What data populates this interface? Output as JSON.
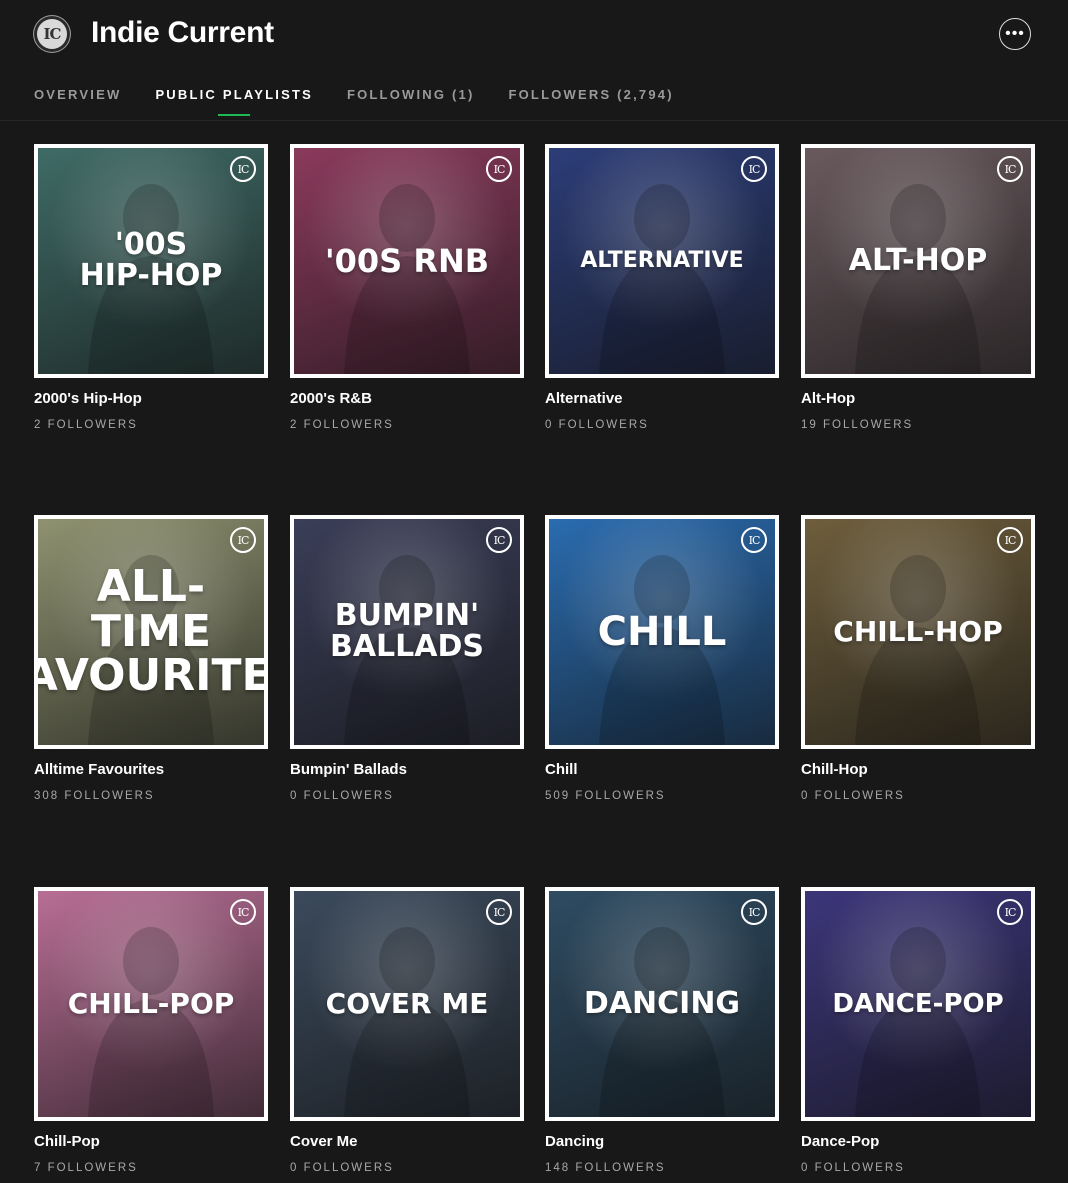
{
  "header": {
    "logo_text": "IC",
    "title": "Indie Current",
    "more_label": "•••"
  },
  "tabs": [
    {
      "label": "OVERVIEW",
      "active": false
    },
    {
      "label": "PUBLIC PLAYLISTS",
      "active": true
    },
    {
      "label": "FOLLOWING (1)",
      "active": false
    },
    {
      "label": "FOLLOWERS (2,794)",
      "active": false
    }
  ],
  "playlists": [
    {
      "name": "2000's Hip-Hop",
      "followers": "2 FOLLOWERS",
      "cover_text": "'00s\nHip-Hop",
      "color": "#3f6b66",
      "text_size": 30
    },
    {
      "name": "2000's R&B",
      "followers": "2 FOLLOWERS",
      "cover_text": "'00s RnB",
      "color": "#8b3a5c",
      "text_size": 32
    },
    {
      "name": "Alternative",
      "followers": "0 FOLLOWERS",
      "cover_text": "Alternative",
      "color": "#2c3d78",
      "text_size": 22
    },
    {
      "name": "Alt-Hop",
      "followers": "19 FOLLOWERS",
      "cover_text": "Alt-Hop",
      "color": "#6a5a5e",
      "text_size": 30
    },
    {
      "name": "Alltime Favourites",
      "followers": "308 FOLLOWERS",
      "cover_text": "All-\nTime\nFavourites",
      "color": "#8f9270",
      "text_size": 44
    },
    {
      "name": "Bumpin' Ballads",
      "followers": "0 FOLLOWERS",
      "cover_text": "Bumpin'\nBallads",
      "color": "#3a3e58",
      "text_size": 30
    },
    {
      "name": "Chill",
      "followers": "509 FOLLOWERS",
      "cover_text": "Chill",
      "color": "#2a6cb0",
      "text_size": 40
    },
    {
      "name": "Chill-Hop",
      "followers": "0 FOLLOWERS",
      "cover_text": "Chill-Hop",
      "color": "#6e5e3c",
      "text_size": 28
    },
    {
      "name": "Chill-Pop",
      "followers": "7 FOLLOWERS",
      "cover_text": "Chill-Pop",
      "color": "#b86e95",
      "text_size": 28
    },
    {
      "name": "Cover Me",
      "followers": "0 FOLLOWERS",
      "cover_text": "Cover Me",
      "color": "#3b4a5c",
      "text_size": 28
    },
    {
      "name": "Dancing",
      "followers": "148 FOLLOWERS",
      "cover_text": "Dancing",
      "color": "#2e4c63",
      "text_size": 30
    },
    {
      "name": "Dance-Pop",
      "followers": "0 FOLLOWERS",
      "cover_text": "Dance-Pop",
      "color": "#3c367a",
      "text_size": 26
    }
  ]
}
